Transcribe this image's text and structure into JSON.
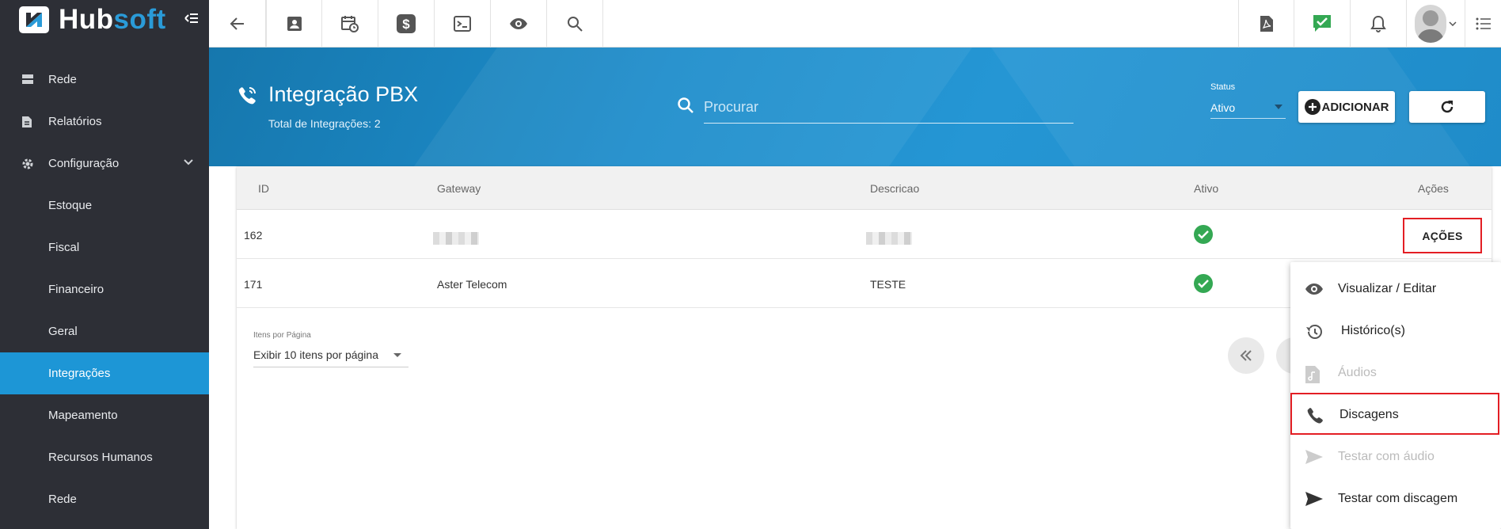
{
  "app": {
    "logo_text_a": "Hub",
    "logo_text_b": "soft"
  },
  "colors": {
    "sidebar": "#2d2f36",
    "active": "#1d96d6",
    "banner": "#1d8dcb",
    "success": "#34a853",
    "highlight": "#e31e24"
  },
  "sidebar": {
    "items": [
      {
        "label": "Rede",
        "icon": "server-icon"
      },
      {
        "label": "Relatórios",
        "icon": "document-icon"
      },
      {
        "label": "Configuração",
        "icon": "gear-icon"
      },
      {
        "label": "Estoque"
      },
      {
        "label": "Fiscal"
      },
      {
        "label": "Financeiro"
      },
      {
        "label": "Geral"
      },
      {
        "label": "Integrações",
        "active": true
      },
      {
        "label": "Mapeamento"
      },
      {
        "label": "Recursos Humanos"
      },
      {
        "label": "Rede"
      }
    ]
  },
  "topbar": {
    "left_icons": [
      "back-arrow-icon",
      "contact-card-icon",
      "calendar-clock-icon",
      "dollar-icon",
      "terminal-icon",
      "eye-icon",
      "search-icon"
    ],
    "right_icons": [
      "pdf-icon",
      "chat-check-icon",
      "bell-icon",
      "avatar",
      "list-icon"
    ]
  },
  "header": {
    "title": "Integração PBX",
    "subtitle": "Total de Integrações: 2",
    "search_placeholder": "Procurar",
    "status_label": "Status",
    "status_value": "Ativo",
    "add_label": "ADICIONAR"
  },
  "table": {
    "columns": [
      "ID",
      "Gateway",
      "Descricao",
      "Ativo",
      "Ações"
    ],
    "rows": [
      {
        "id": "162",
        "gateway": "",
        "descricao": "",
        "ativo": true,
        "acoes": "AÇÕES"
      },
      {
        "id": "171",
        "gateway": "Aster Telecom",
        "descricao": "TESTE",
        "ativo": true
      }
    ]
  },
  "pagination": {
    "label": "Itens por Página",
    "value": "Exibir 10 itens por página"
  },
  "menu": {
    "items": [
      {
        "label": "Visualizar / Editar",
        "icon": "eye-icon",
        "enabled": true
      },
      {
        "label": "Histórico(s)",
        "icon": "history-icon",
        "enabled": true
      },
      {
        "label": "Áudios",
        "icon": "audio-file-icon",
        "enabled": false
      },
      {
        "label": "Discagens",
        "icon": "phone-icon",
        "enabled": true
      },
      {
        "label": "Testar com áudio",
        "icon": "send-icon",
        "enabled": false
      },
      {
        "label": "Testar com discagem",
        "icon": "send-icon",
        "enabled": true
      }
    ]
  }
}
